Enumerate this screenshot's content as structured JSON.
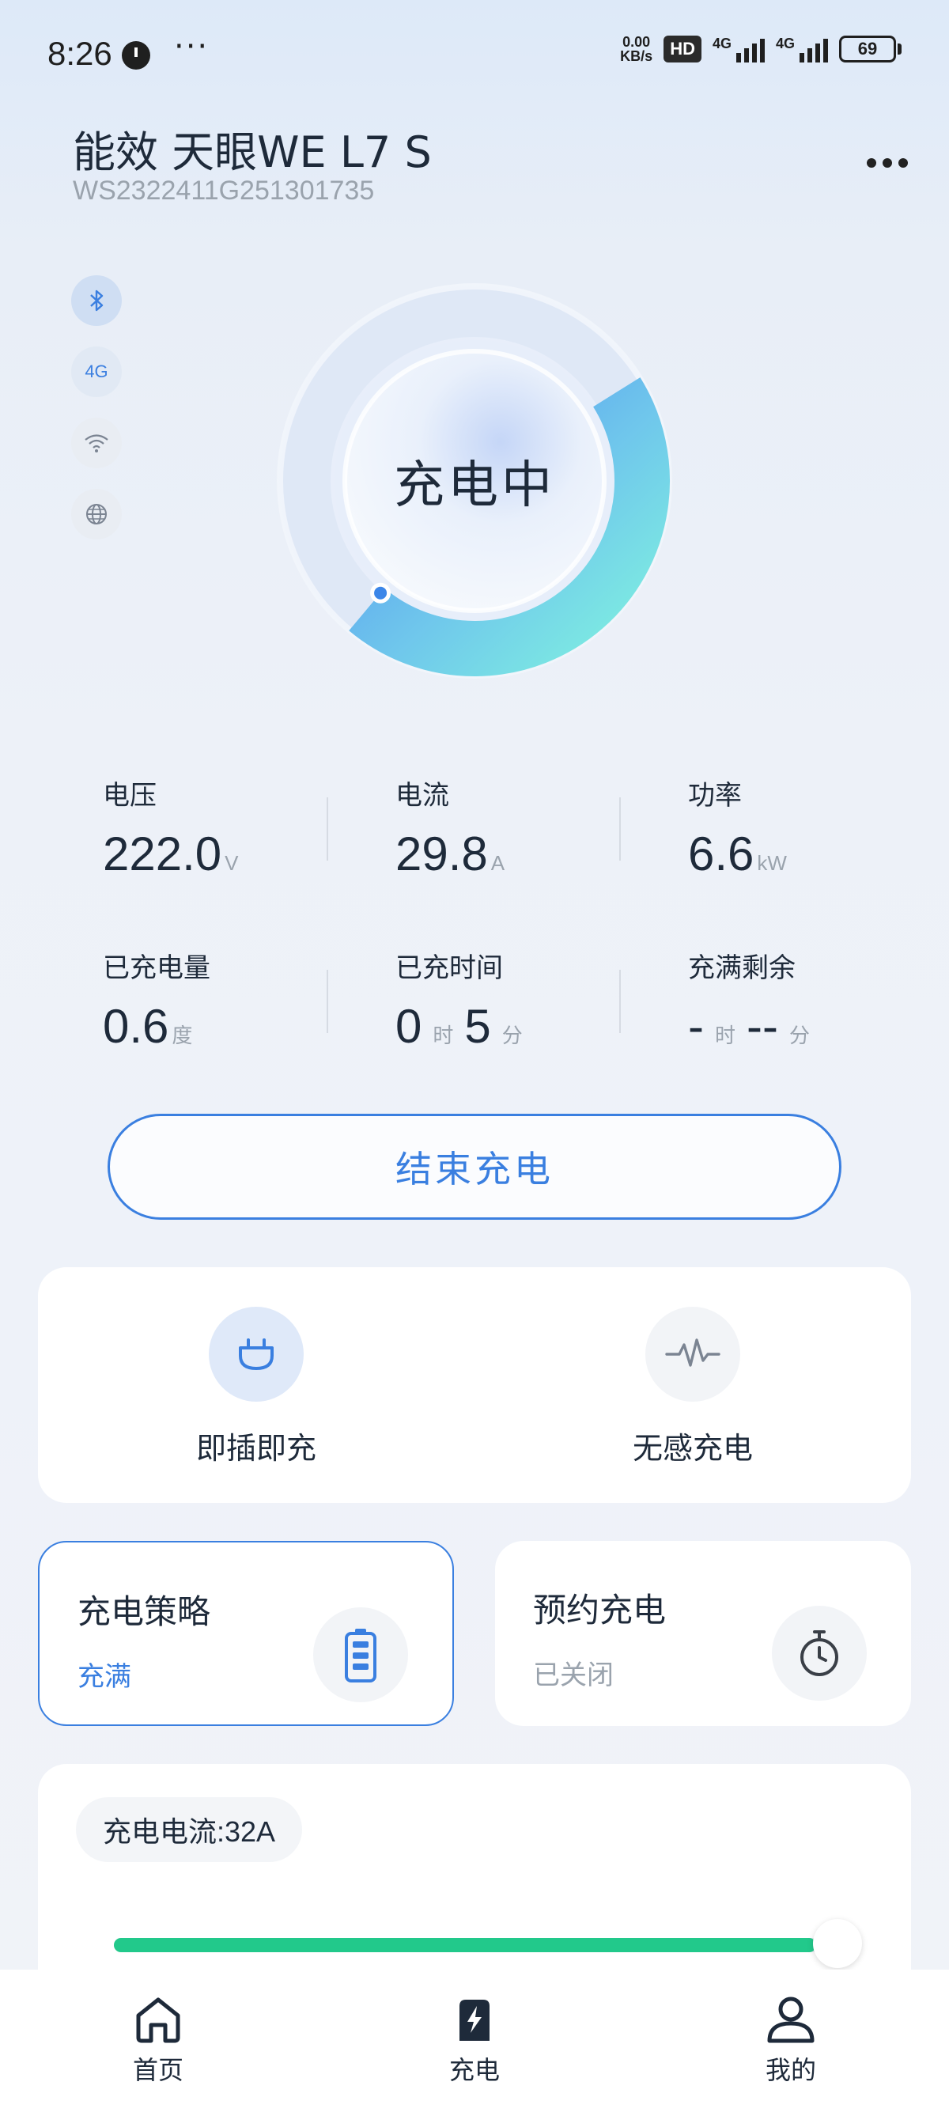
{
  "status_bar": {
    "time": "8:26",
    "dots": "···",
    "net_speed_value": "0.00",
    "net_speed_unit": "KB/s",
    "hd": "HD",
    "sig1_label": "4G",
    "sig2_label": "4G",
    "battery": "69"
  },
  "device": {
    "title": "能效 天眼WE L7 S",
    "serial": "WS2322411G251301735"
  },
  "connections": {
    "four_g": "4G"
  },
  "dial": {
    "status": "充电中",
    "progress_fraction": 0.45
  },
  "metrics": {
    "voltage": {
      "label": "电压",
      "value": "222.0",
      "unit": "V"
    },
    "current": {
      "label": "电流",
      "value": "29.8",
      "unit": "A"
    },
    "power": {
      "label": "功率",
      "value": "6.6",
      "unit": "kW"
    },
    "charged": {
      "label": "已充电量",
      "value": "0.6",
      "unit": "度"
    },
    "elapsed": {
      "label": "已充时间",
      "hours": "0",
      "hours_unit": "时",
      "minutes": "5",
      "minutes_unit": "分"
    },
    "remaining": {
      "label": "充满剩余",
      "hours": "-",
      "hours_unit": "时",
      "minutes": "--",
      "minutes_unit": "分"
    }
  },
  "end_button": "结束充电",
  "modes": {
    "plug_and_charge": "即插即充",
    "seamless_charge": "无感充电"
  },
  "strategy": {
    "title": "充电策略",
    "value": "充满"
  },
  "schedule": {
    "title": "预约充电",
    "value": "已关闭"
  },
  "current_setting": {
    "label": "充电电流:32A",
    "level_fraction": 1.0
  },
  "colors": {
    "accent": "#3a7fe0",
    "slider": "#22c98b",
    "muted": "#9aa3ad"
  },
  "nav": {
    "home": "首页",
    "charge": "充电",
    "mine": "我的"
  }
}
